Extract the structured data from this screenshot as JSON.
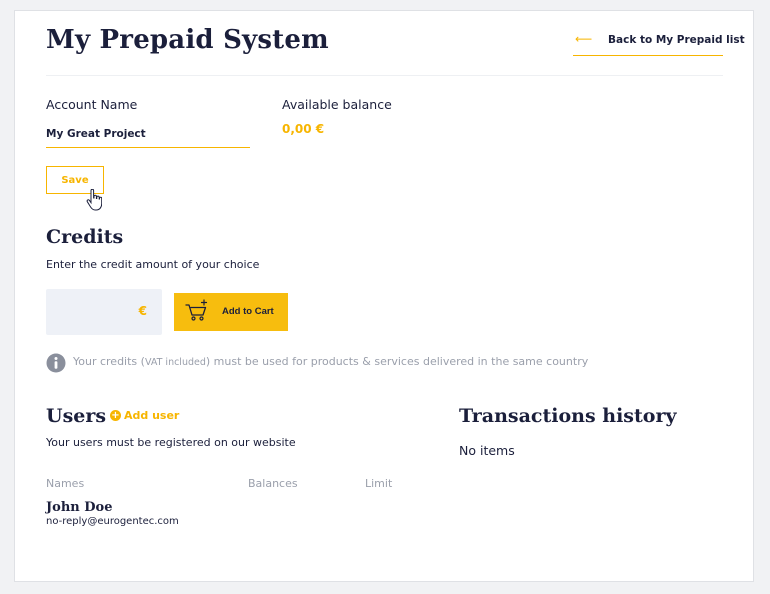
{
  "header": {
    "title": "My Prepaid System",
    "back_label": "Back to My Prepaid list",
    "back_arrow": "⟵"
  },
  "account": {
    "name_label": "Account Name",
    "name_value": "My Great Project",
    "balance_label": "Available balance",
    "balance_value": "0,00 €",
    "save_label": "Save"
  },
  "credits": {
    "title": "Credits",
    "subtitle": "Enter the credit amount of your choice",
    "amount_value": "",
    "currency": "€",
    "add_to_cart_label": "Add to Cart",
    "info_prefix": "Your credits (",
    "info_vat": "VAT included",
    "info_suffix": ") must be used for products & services delivered in the same country"
  },
  "users": {
    "title": "Users",
    "add_user_label": "Add user",
    "subtitle": "Your users must be registered on our website",
    "columns": [
      "Names",
      "Balances",
      "Limit"
    ],
    "rows": [
      {
        "name": "John Doe",
        "email": "no-reply@eurogentec.com"
      }
    ]
  },
  "transactions": {
    "title": "Transactions history",
    "empty_text": "No items"
  },
  "colors": {
    "accent": "#f7b500",
    "text": "#1b1f3b",
    "muted": "#9a9fab",
    "input_bg": "#eef1f7"
  },
  "icons": {
    "back": "arrow-left-icon",
    "cursor": "hand-pointer-icon",
    "cart": "cart-add-icon",
    "info": "info-icon",
    "add_user": "plus-circle-icon"
  }
}
